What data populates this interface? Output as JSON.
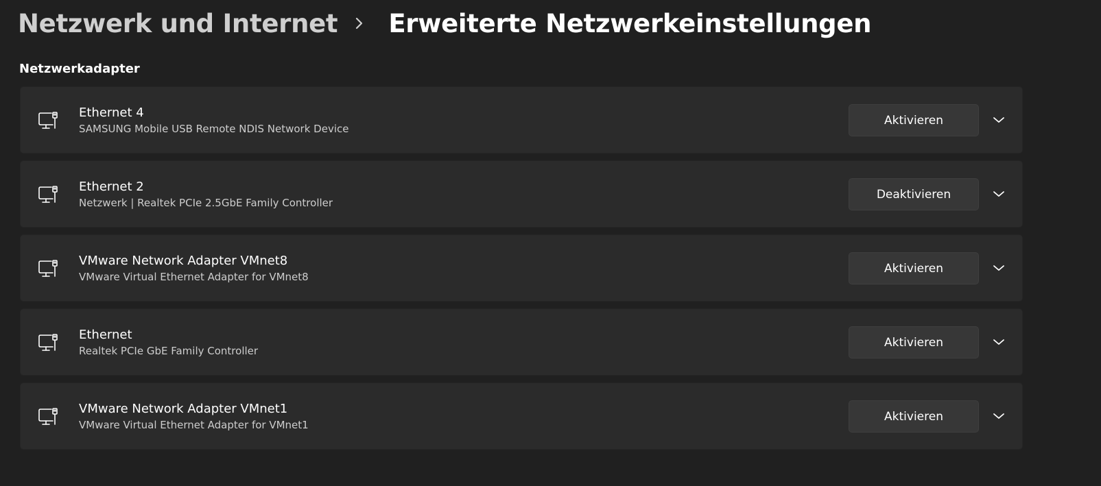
{
  "breadcrumb": {
    "parent": "Netzwerk und Internet",
    "separator_icon": "chevron-right-icon",
    "current": "Erweiterte Netzwerkeinstellungen"
  },
  "section": {
    "title": "Netzwerkadapter"
  },
  "adapters": [
    {
      "name": "Ethernet 4",
      "description": "SAMSUNG Mobile USB Remote NDIS Network Device",
      "button_label": "Aktivieren",
      "icon": "ethernet-adapter-icon"
    },
    {
      "name": "Ethernet 2",
      "description": "Netzwerk | Realtek PCIe 2.5GbE Family Controller",
      "button_label": "Deaktivieren",
      "icon": "ethernet-adapter-icon"
    },
    {
      "name": "VMware Network Adapter VMnet8",
      "description": "VMware Virtual Ethernet Adapter for VMnet8",
      "button_label": "Aktivieren",
      "icon": "ethernet-adapter-icon"
    },
    {
      "name": "Ethernet",
      "description": "Realtek PCIe GbE Family Controller",
      "button_label": "Aktivieren",
      "icon": "ethernet-adapter-icon"
    },
    {
      "name": "VMware Network Adapter VMnet1",
      "description": "VMware Virtual Ethernet Adapter for VMnet1",
      "button_label": "Aktivieren",
      "icon": "ethernet-adapter-icon"
    }
  ],
  "colors": {
    "background": "#202020",
    "card": "#2b2b2b",
    "button": "#373737",
    "text_primary": "#ffffff",
    "text_secondary": "#cdcdcd"
  }
}
